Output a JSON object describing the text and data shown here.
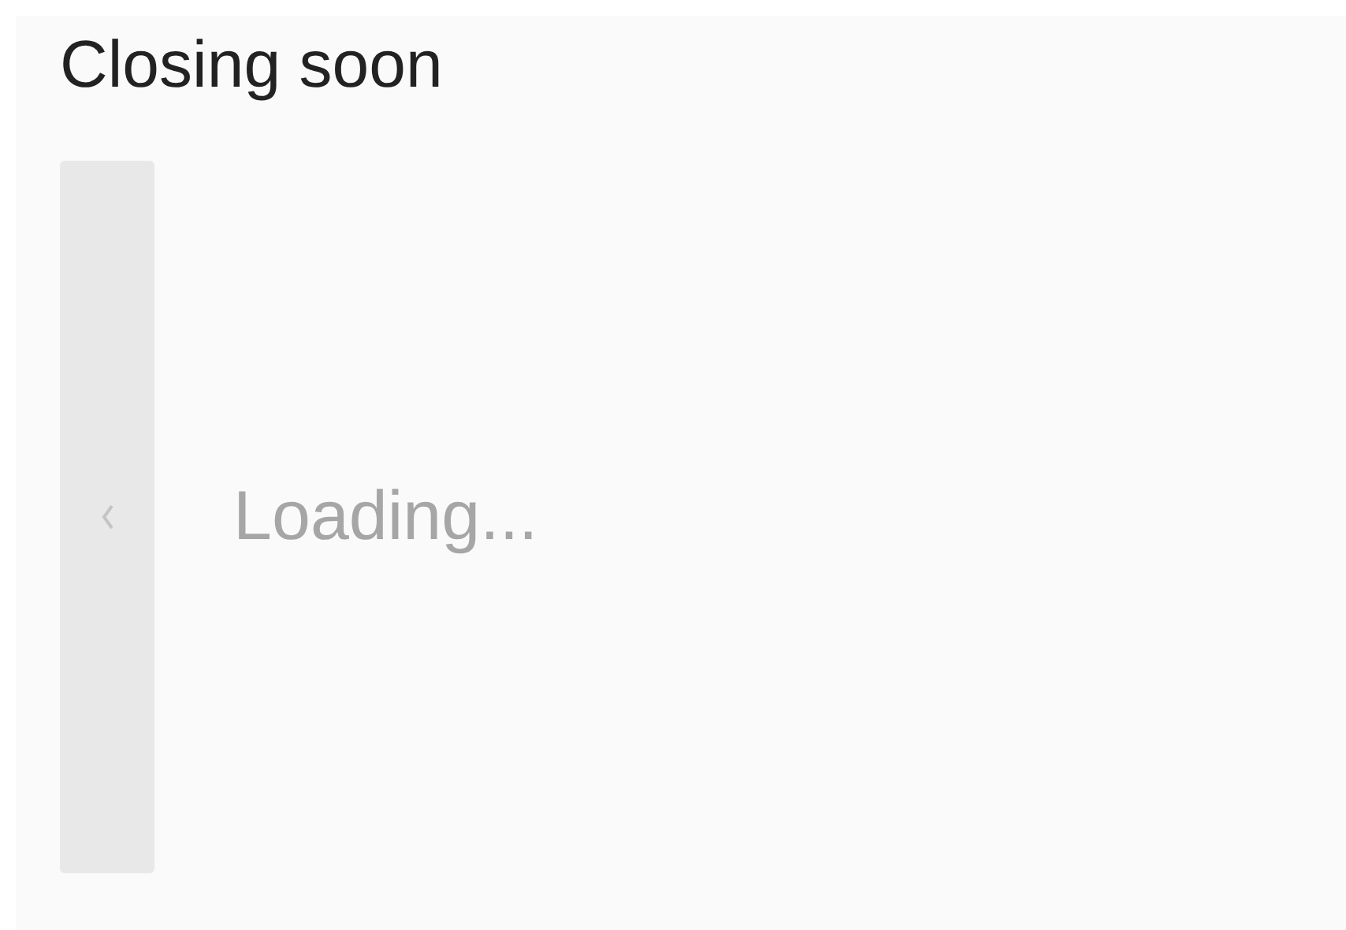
{
  "section": {
    "title": "Closing soon"
  },
  "carousel": {
    "status": "Loading..."
  }
}
